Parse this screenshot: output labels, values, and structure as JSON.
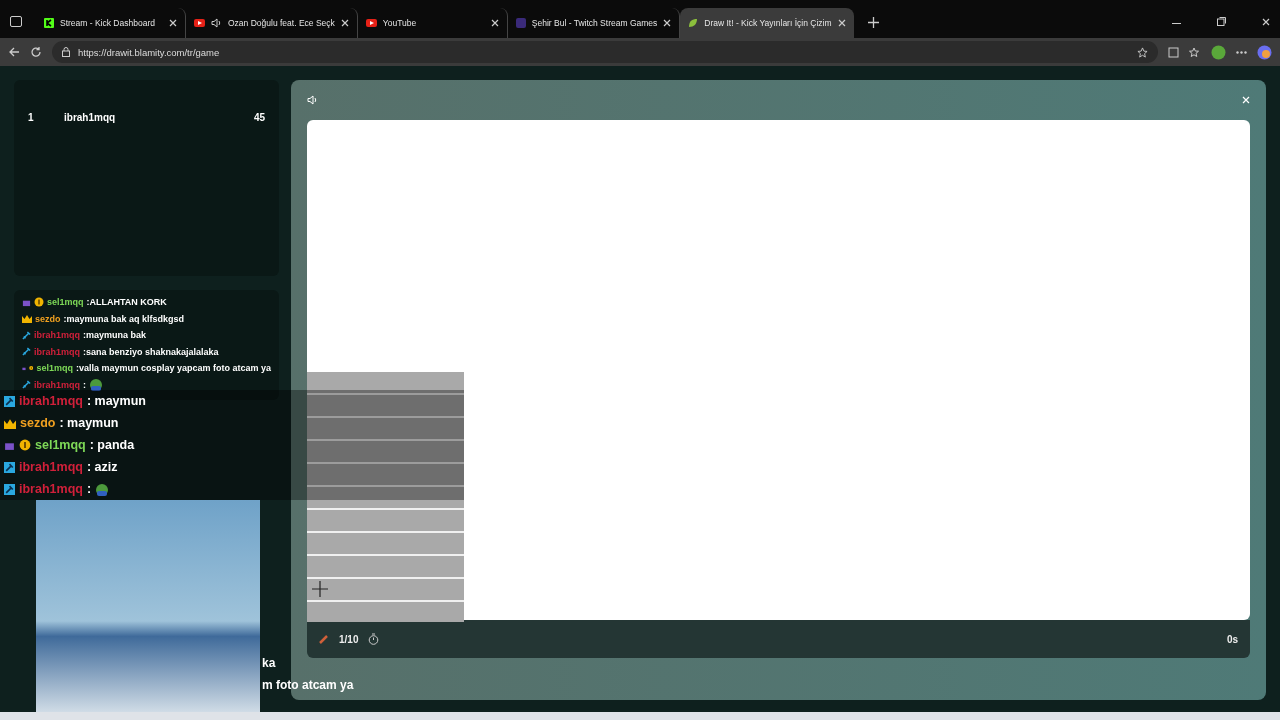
{
  "tabs": [
    {
      "kind": "kick",
      "title": "Stream - Kick Dashboard",
      "selected": false,
      "playing_audio": false
    },
    {
      "kind": "youtube",
      "title": "Ozan Doğulu feat. Ece Seçk",
      "selected": false,
      "playing_audio": true
    },
    {
      "kind": "youtube",
      "title": "YouTube",
      "selected": false,
      "playing_audio": false
    },
    {
      "kind": "twitch",
      "title": "Şehir Bul - Twitch Stream Games",
      "selected": false,
      "playing_audio": false
    },
    {
      "kind": "drawit",
      "title": "Draw It! - Kick Yayınları İçin Çizim",
      "selected": true,
      "playing_audio": false
    }
  ],
  "address_bar": {
    "url": "https://drawit.blamity.com/tr/game"
  },
  "scoreboard": [
    {
      "rank": "1",
      "name": "ibrah1mqq",
      "score": "45"
    }
  ],
  "chat": [
    {
      "kind": "subscriber",
      "user": "sel1mqq",
      "color": "#7ed957",
      "text": ":ALLAHTAN KORK"
    },
    {
      "kind": "owner",
      "user": "sezdo",
      "color": "#f0a020",
      "text": ":maymuna bak aq klfsdkgsd"
    },
    {
      "kind": "moderator",
      "user": "ibrah1mqq",
      "color": "#d0203a",
      "text": ":maymuna bak"
    },
    {
      "kind": "moderator",
      "user": "ibrah1mqq",
      "color": "#d0203a",
      "text": ":sana benziyo shaknakajalalaka"
    },
    {
      "kind": "subscriber",
      "user": "sel1mqq",
      "color": "#7ed957",
      "text": ":valla maymun cosplay yapcam foto atcam ya"
    },
    {
      "kind": "moderator",
      "user": "ibrah1mqq",
      "color": "#d0203a",
      "text": ":",
      "emote": true
    }
  ],
  "stream_chat": [
    {
      "kind": "moderator",
      "user": "ibrah1mqq",
      "color": "#d0203a",
      "text": ": maymun"
    },
    {
      "kind": "owner",
      "user": "sezdo",
      "color": "#f0a020",
      "text": ": maymun"
    },
    {
      "kind": "subscriber",
      "user": "sel1mqq",
      "color": "#7ed957",
      "text": ": panda"
    },
    {
      "kind": "moderator",
      "user": "ibrah1mqq",
      "color": "#d0203a",
      "text": ": aziz"
    },
    {
      "kind": "moderator",
      "user": "ibrah1mqq",
      "color": "#d0203a",
      "text": ":",
      "emote": true
    }
  ],
  "stream_chat_fragments": [
    "ka",
    "m foto atcam ya"
  ],
  "drawing_modal": {
    "round": "1/10",
    "timer": "0s"
  }
}
